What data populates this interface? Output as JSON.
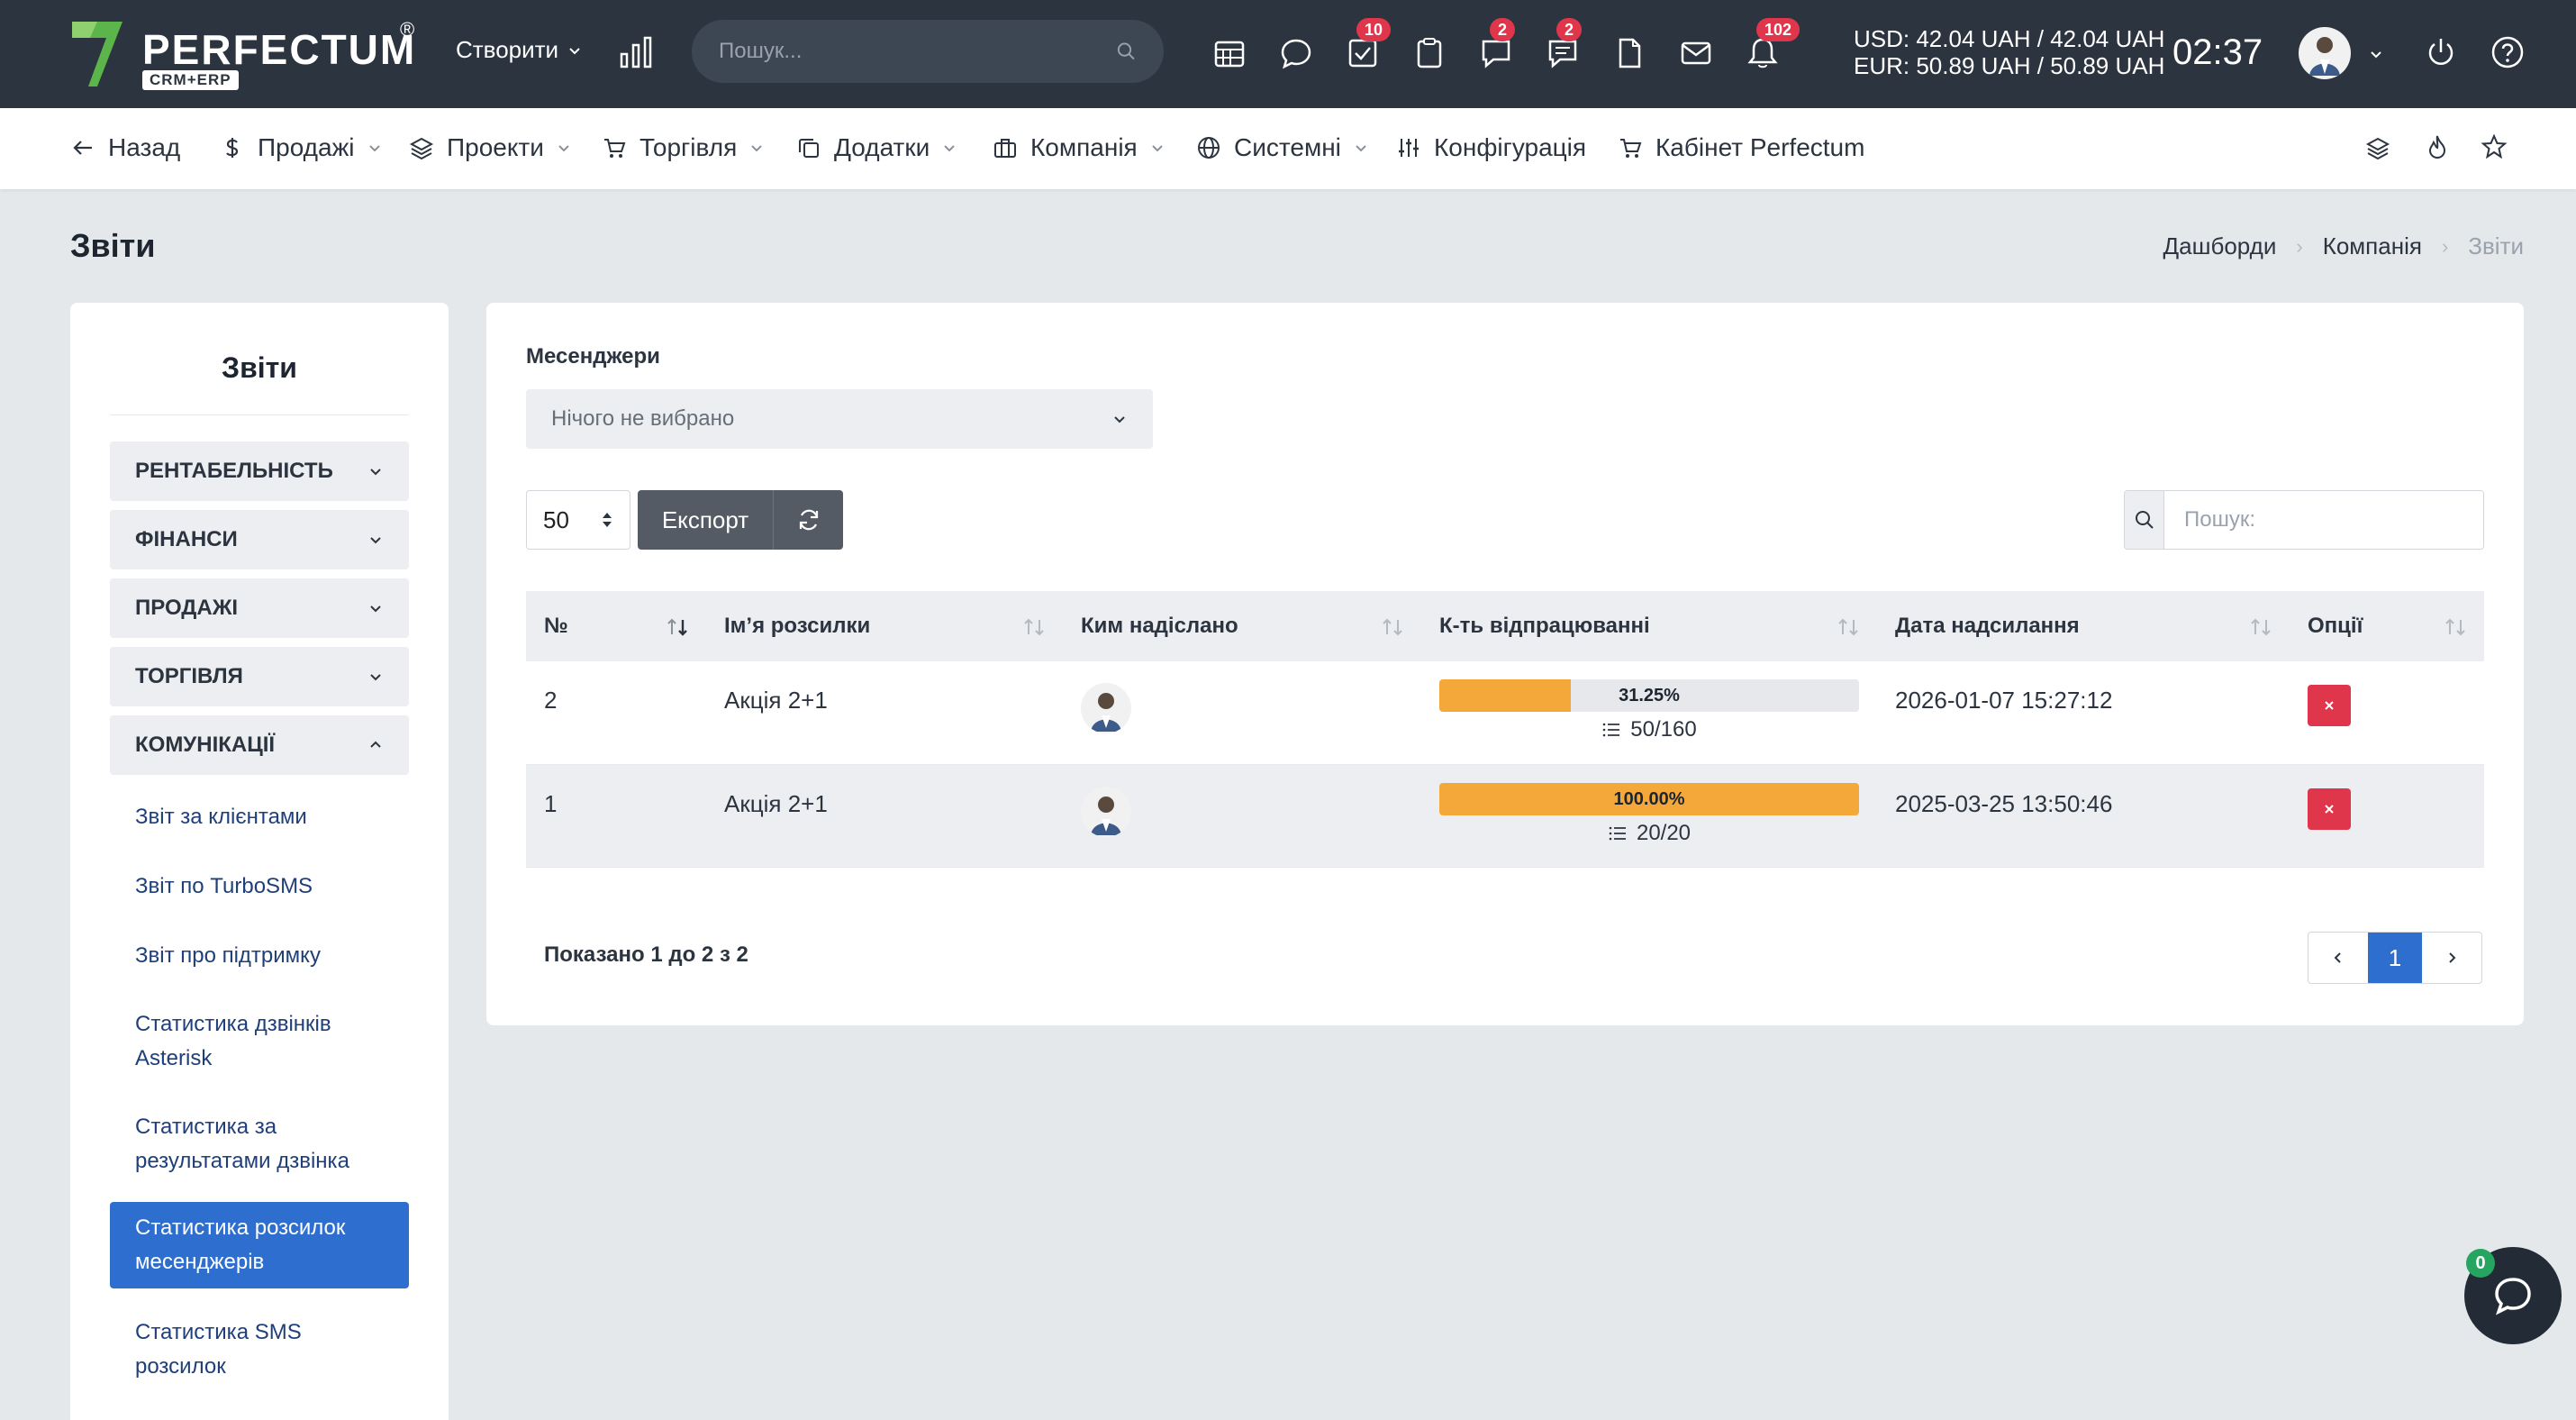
{
  "brand": {
    "name": "PERFECTUM",
    "reg": "®",
    "sub": "CRM+ERP"
  },
  "topbar": {
    "create_label": "Створити",
    "search_placeholder": "Пошук...",
    "badges": {
      "tasks": "10",
      "comments": "2",
      "notes": "2",
      "notifications": "102"
    },
    "currency_usd": "USD: 42.04 UAH / 42.04 UAH",
    "currency_eur": "EUR: 50.89 UAH / 50.89 UAH",
    "time": "02:37"
  },
  "nav": {
    "back": "Назад",
    "sales": "Продажі",
    "projects": "Проекти",
    "trade": "Торгівля",
    "addons": "Додатки",
    "company": "Компанія",
    "system": "Системні",
    "config": "Конфігурація",
    "cabinet": "Кабінет Perfectum"
  },
  "page": {
    "title": "Звіти",
    "breadcrumb": [
      "Дашборди",
      "Компанія",
      "Звіти"
    ]
  },
  "sidebar": {
    "title": "Звіти",
    "sections": [
      "РЕНТАБЕЛЬНІСТЬ",
      "ФІНАНСИ",
      "ПРОДАЖІ",
      "ТОРГІВЛЯ",
      "КОМУНІКАЦІЇ"
    ],
    "items": [
      "Звіт за клієнтами",
      "Звіт по TurboSMS",
      "Звіт про підтримку",
      "Статистика дзвінків Asterisk",
      "Статистика за результатами дзвінка",
      "Статистика розсилок месенджерів",
      "Статистика SMS розсилок"
    ]
  },
  "filters": {
    "label": "Месенджери",
    "select_value": "Нічого не вибрано",
    "page_length": "50",
    "export_label": "Експорт",
    "search_placeholder": "Пошук:"
  },
  "table": {
    "headers": [
      "№",
      "Ім’я розсилки",
      "Ким надіслано",
      "К-ть відпрацюванні",
      "Дата надсилання",
      "Опції"
    ],
    "rows": [
      {
        "num": "2",
        "name": "Акція 2+1",
        "progress": 31.25,
        "progress_label": "31.25%",
        "count": "50/160",
        "date": "2026-01-07 15:27:12"
      },
      {
        "num": "1",
        "name": "Акція 2+1",
        "progress": 100,
        "progress_label": "100.00%",
        "count": "20/20",
        "date": "2025-03-25 13:50:46"
      }
    ]
  },
  "footer": {
    "info": "Показано 1 до 2 з 2",
    "page": "1"
  },
  "chat": {
    "badge": "0"
  },
  "colors": {
    "accent": "#2d6ecf",
    "progress": "#f5a83a",
    "danger": "#e0364b",
    "topbar": "#2c3440"
  }
}
